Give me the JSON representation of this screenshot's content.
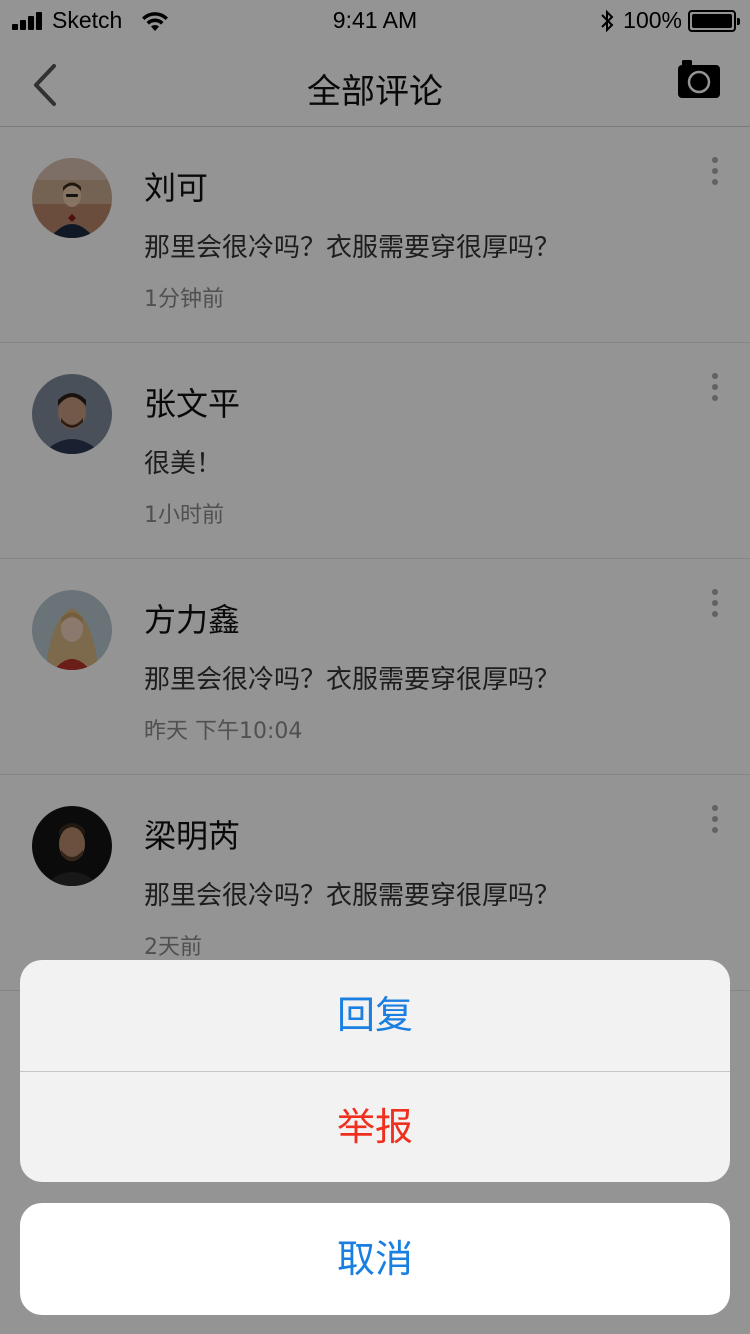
{
  "status_bar": {
    "carrier": "Sketch",
    "time": "9:41 AM",
    "battery": "100%"
  },
  "nav": {
    "title": "全部评论",
    "back_icon": "chevron-left-icon",
    "camera_icon": "camera-icon"
  },
  "comments": [
    {
      "name": "刘可",
      "text": "那里会很冷吗？衣服需要穿很厚吗？",
      "time": "1分钟前"
    },
    {
      "name": "张文平",
      "text": "很美！",
      "time": "1小时前"
    },
    {
      "name": "方力鑫",
      "text": "那里会很冷吗？衣服需要穿很厚吗？",
      "time": "昨天  下午10:04"
    },
    {
      "name": "梁明芮",
      "text": "那里会很冷吗？衣服需要穿很厚吗？",
      "time": "2天前"
    }
  ],
  "action_sheet": {
    "reply": "回复",
    "report": "举报",
    "cancel": "取消"
  },
  "colors": {
    "action_blue": "#1a7fe0",
    "action_red": "#f0301e"
  }
}
